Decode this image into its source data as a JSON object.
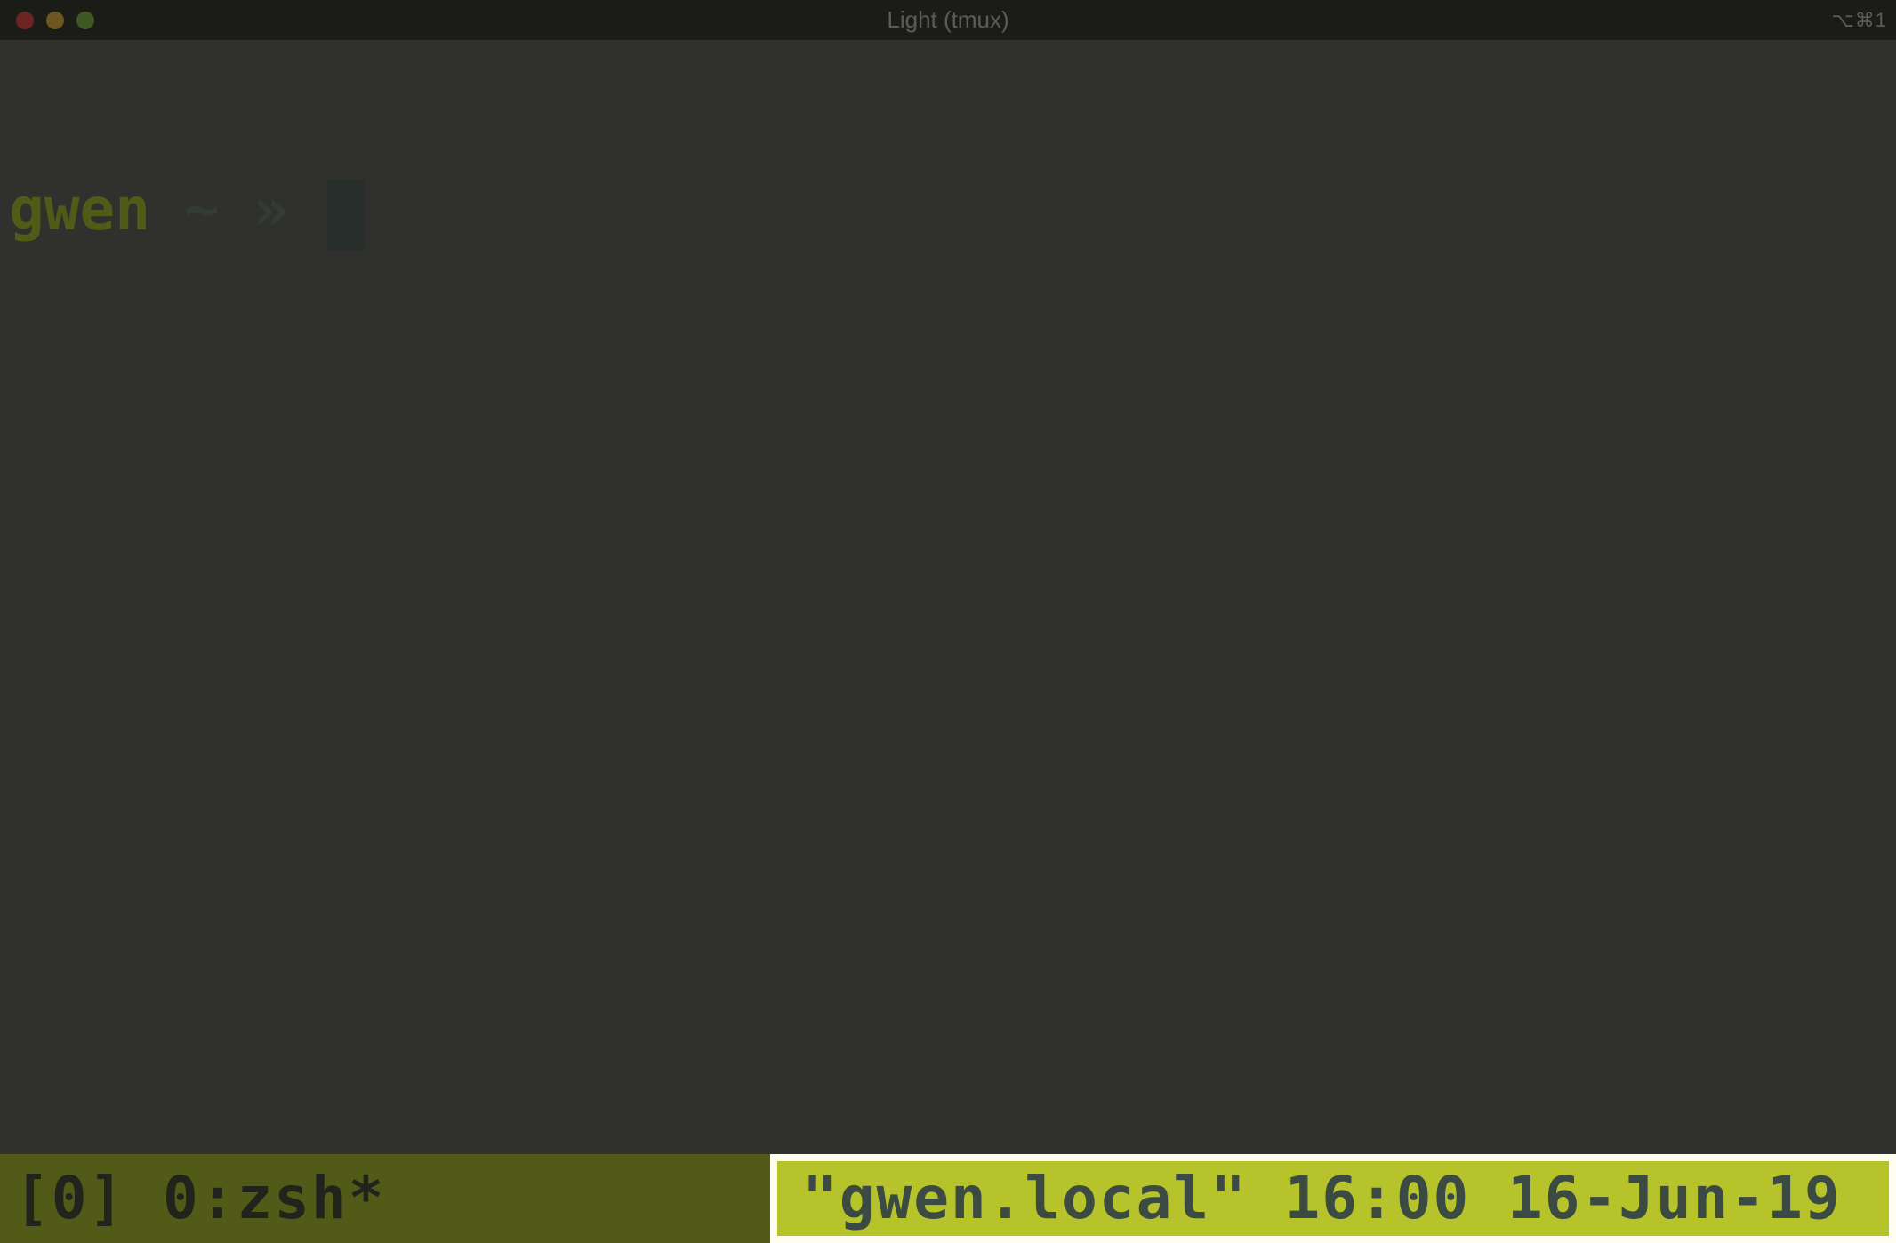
{
  "titlebar": {
    "title": "Light (tmux)",
    "right_indicator": "⌥⌘1"
  },
  "prompt": {
    "user": "gwen",
    "path": "~",
    "arrow": "»"
  },
  "tmux": {
    "status_left": "[0] 0:zsh*",
    "status_right": "\"gwen.local\" 16:00 16-Jun-19"
  }
}
